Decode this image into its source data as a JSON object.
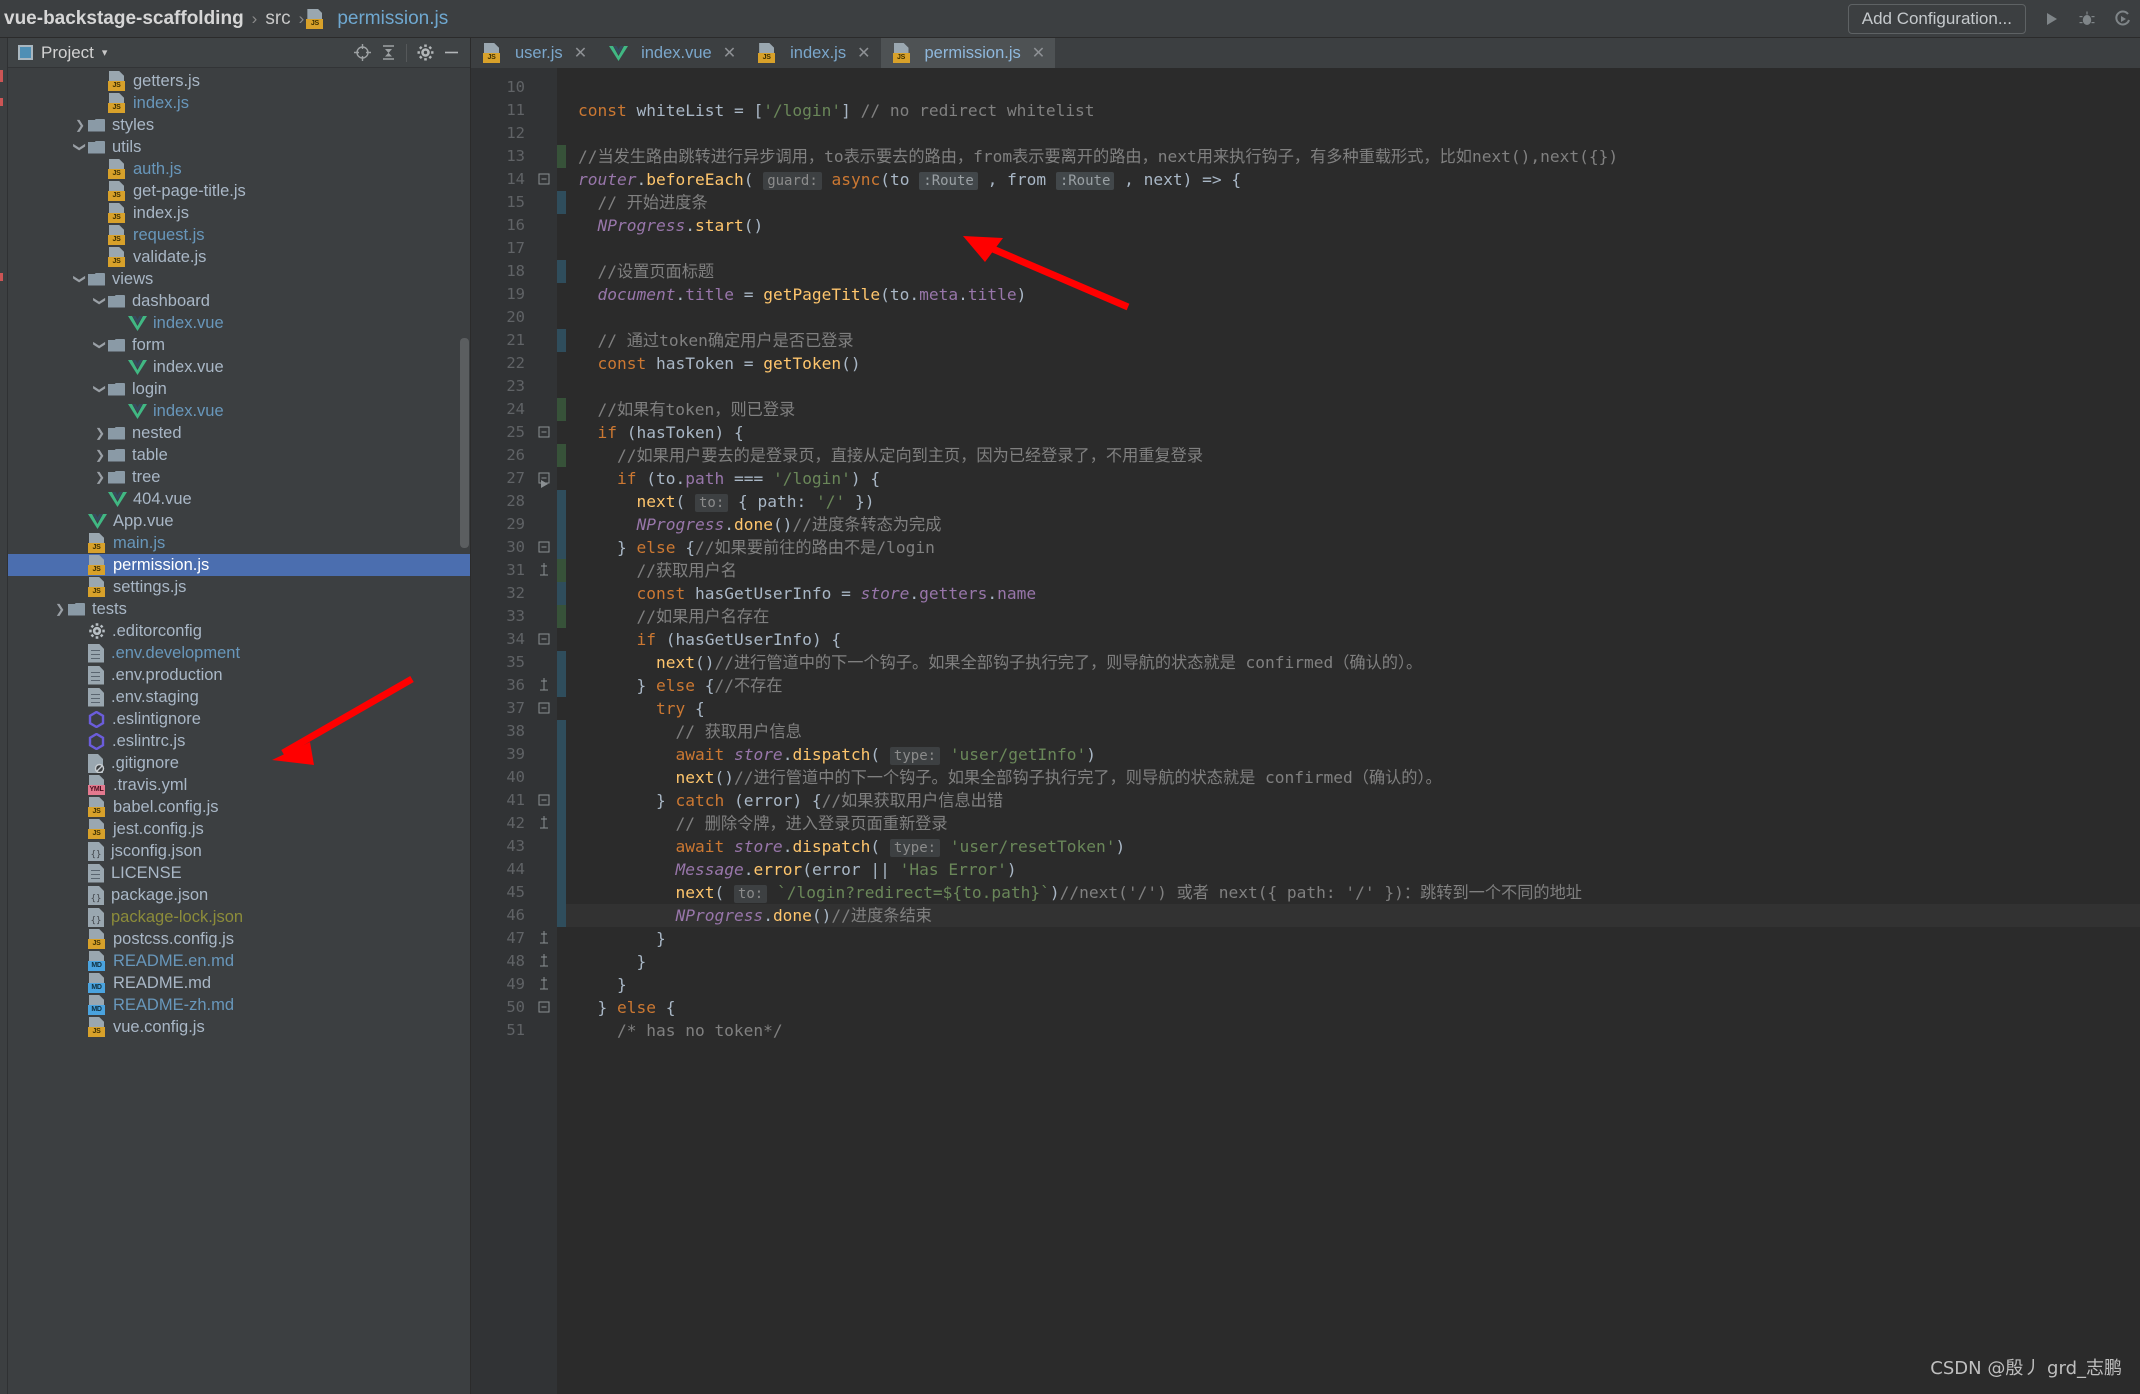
{
  "topbar": {
    "breadcrumb": [
      {
        "label": "vue-backstage-scaffolding",
        "type": "project"
      },
      {
        "label": "src",
        "type": "folder"
      },
      {
        "label": "permission.js",
        "type": "js-file"
      }
    ],
    "separator": "›",
    "add_configuration_label": "Add Configuration...",
    "run_icon": "run-icon",
    "debug_icon": "debug-icon",
    "coverage_icon": "run-with-coverage-icon"
  },
  "project_panel": {
    "title": "Project",
    "caret": "▾",
    "window_icon": "project-window-icon",
    "locate_icon": "select-opened-file-icon",
    "collapse_icon": "collapse-all-icon",
    "settings_icon": "gear-icon",
    "hide_icon": "hide-icon",
    "tree": [
      {
        "label": "getters.js",
        "indent": 4,
        "icon": "js",
        "color": "grey",
        "arrow": ""
      },
      {
        "label": "index.js",
        "indent": 4,
        "icon": "js",
        "color": "blue",
        "arrow": ""
      },
      {
        "label": "styles",
        "indent": 3,
        "icon": "folder",
        "color": "grey",
        "arrow": "›"
      },
      {
        "label": "utils",
        "indent": 3,
        "icon": "folder",
        "color": "grey",
        "arrow": "ˇ"
      },
      {
        "label": "auth.js",
        "indent": 4,
        "icon": "js",
        "color": "blue",
        "arrow": ""
      },
      {
        "label": "get-page-title.js",
        "indent": 4,
        "icon": "js",
        "color": "grey",
        "arrow": ""
      },
      {
        "label": "index.js",
        "indent": 4,
        "icon": "js",
        "color": "grey",
        "arrow": ""
      },
      {
        "label": "request.js",
        "indent": 4,
        "icon": "js",
        "color": "blue",
        "arrow": ""
      },
      {
        "label": "validate.js",
        "indent": 4,
        "icon": "js",
        "color": "grey",
        "arrow": ""
      },
      {
        "label": "views",
        "indent": 3,
        "icon": "folder",
        "color": "grey",
        "arrow": "ˇ"
      },
      {
        "label": "dashboard",
        "indent": 4,
        "icon": "folder",
        "color": "grey",
        "arrow": "ˇ"
      },
      {
        "label": "index.vue",
        "indent": 5,
        "icon": "vue",
        "color": "blue",
        "arrow": ""
      },
      {
        "label": "form",
        "indent": 4,
        "icon": "folder",
        "color": "grey",
        "arrow": "ˇ"
      },
      {
        "label": "index.vue",
        "indent": 5,
        "icon": "vue",
        "color": "grey",
        "arrow": ""
      },
      {
        "label": "login",
        "indent": 4,
        "icon": "folder",
        "color": "grey",
        "arrow": "ˇ"
      },
      {
        "label": "index.vue",
        "indent": 5,
        "icon": "vue",
        "color": "blue",
        "arrow": ""
      },
      {
        "label": "nested",
        "indent": 4,
        "icon": "folder",
        "color": "grey",
        "arrow": "›"
      },
      {
        "label": "table",
        "indent": 4,
        "icon": "folder",
        "color": "grey",
        "arrow": "›"
      },
      {
        "label": "tree",
        "indent": 4,
        "icon": "folder",
        "color": "grey",
        "arrow": "›"
      },
      {
        "label": "404.vue",
        "indent": 4,
        "icon": "vue",
        "color": "grey",
        "arrow": ""
      },
      {
        "label": "App.vue",
        "indent": 3,
        "icon": "vue",
        "color": "grey",
        "arrow": ""
      },
      {
        "label": "main.js",
        "indent": 3,
        "icon": "js",
        "color": "blue",
        "arrow": ""
      },
      {
        "label": "permission.js",
        "indent": 3,
        "icon": "js",
        "color": "white",
        "arrow": "",
        "selected": true
      },
      {
        "label": "settings.js",
        "indent": 3,
        "icon": "js",
        "color": "grey",
        "arrow": ""
      },
      {
        "label": "tests",
        "indent": 2,
        "icon": "folder",
        "color": "grey",
        "arrow": "›"
      },
      {
        "label": ".editorconfig",
        "indent": 3,
        "icon": "gear",
        "color": "grey",
        "arrow": ""
      },
      {
        "label": ".env.development",
        "indent": 3,
        "icon": "doc",
        "color": "blue",
        "arrow": ""
      },
      {
        "label": ".env.production",
        "indent": 3,
        "icon": "doc",
        "color": "grey",
        "arrow": ""
      },
      {
        "label": ".env.staging",
        "indent": 3,
        "icon": "doc",
        "color": "grey",
        "arrow": ""
      },
      {
        "label": ".eslintignore",
        "indent": 3,
        "icon": "eslint",
        "color": "grey",
        "arrow": ""
      },
      {
        "label": ".eslintrc.js",
        "indent": 3,
        "icon": "eslint",
        "color": "grey",
        "arrow": ""
      },
      {
        "label": ".gitignore",
        "indent": 3,
        "icon": "git",
        "color": "grey",
        "arrow": ""
      },
      {
        "label": ".travis.yml",
        "indent": 3,
        "icon": "yml",
        "color": "grey",
        "arrow": ""
      },
      {
        "label": "babel.config.js",
        "indent": 3,
        "icon": "js",
        "color": "grey",
        "arrow": ""
      },
      {
        "label": "jest.config.js",
        "indent": 3,
        "icon": "js",
        "color": "grey",
        "arrow": ""
      },
      {
        "label": "jsconfig.json",
        "indent": 3,
        "icon": "json",
        "color": "grey",
        "arrow": ""
      },
      {
        "label": "LICENSE",
        "indent": 3,
        "icon": "doc",
        "color": "grey",
        "arrow": ""
      },
      {
        "label": "package.json",
        "indent": 3,
        "icon": "json",
        "color": "grey",
        "arrow": ""
      },
      {
        "label": "package-lock.json",
        "indent": 3,
        "icon": "json",
        "color": "olive",
        "arrow": ""
      },
      {
        "label": "postcss.config.js",
        "indent": 3,
        "icon": "js",
        "color": "grey",
        "arrow": ""
      },
      {
        "label": "README.en.md",
        "indent": 3,
        "icon": "md",
        "color": "blue",
        "arrow": ""
      },
      {
        "label": "README.md",
        "indent": 3,
        "icon": "md",
        "color": "grey",
        "arrow": ""
      },
      {
        "label": "README-zh.md",
        "indent": 3,
        "icon": "md",
        "color": "blue",
        "arrow": ""
      },
      {
        "label": "vue.config.js",
        "indent": 3,
        "icon": "js",
        "color": "grey",
        "arrow": ""
      }
    ]
  },
  "editor": {
    "tabs": [
      {
        "label": "user.js",
        "icon": "js",
        "active": false,
        "close": "✕"
      },
      {
        "label": "index.vue",
        "icon": "vue",
        "active": false,
        "close": "✕"
      },
      {
        "label": "index.js",
        "icon": "js",
        "active": false,
        "close": "✕"
      },
      {
        "label": "permission.js",
        "icon": "js",
        "active": true,
        "close": "✕"
      }
    ],
    "first_line_number": 10,
    "caret_line": 46,
    "lines": [
      {
        "n": 10,
        "text": ""
      },
      {
        "n": 11,
        "text": "const whiteList = ['/login'] // no redirect whitelist"
      },
      {
        "n": 12,
        "text": ""
      },
      {
        "n": 13,
        "text": "//当发生路由跳转进行异步调用，to表示要去的路由，from表示要离开的路由，next用来执行钩子，有多种重载形式，比如next(),next({})"
      },
      {
        "n": 14,
        "text": "router.beforeEach( guard: async(to :Route , from :Route , next) => {"
      },
      {
        "n": 15,
        "text": "  // 开始进度条"
      },
      {
        "n": 16,
        "text": "  NProgress.start()"
      },
      {
        "n": 17,
        "text": ""
      },
      {
        "n": 18,
        "text": "  //设置页面标题"
      },
      {
        "n": 19,
        "text": "  document.title = getPageTitle(to.meta.title)"
      },
      {
        "n": 20,
        "text": ""
      },
      {
        "n": 21,
        "text": "  // 通过token确定用户是否已登录"
      },
      {
        "n": 22,
        "text": "  const hasToken = getToken()"
      },
      {
        "n": 23,
        "text": ""
      },
      {
        "n": 24,
        "text": "  //如果有token，则已登录"
      },
      {
        "n": 25,
        "text": "  if (hasToken) {"
      },
      {
        "n": 26,
        "text": "    //如果用户要去的是登录页，直接从定向到主页，因为已经登录了，不用重复登录"
      },
      {
        "n": 27,
        "text": "    if (to.path === '/login') {"
      },
      {
        "n": 28,
        "text": "      next( to: { path: '/' })"
      },
      {
        "n": 29,
        "text": "      NProgress.done()//进度条转态为完成"
      },
      {
        "n": 30,
        "text": "    } else {//如果要前往的路由不是/login"
      },
      {
        "n": 31,
        "text": "      //获取用户名"
      },
      {
        "n": 32,
        "text": "      const hasGetUserInfo = store.getters.name"
      },
      {
        "n": 33,
        "text": "      //如果用户名存在"
      },
      {
        "n": 34,
        "text": "      if (hasGetUserInfo) {"
      },
      {
        "n": 35,
        "text": "        next()//进行管道中的下一个钩子。如果全部钩子执行完了，则导航的状态就是 confirmed（确认的）。"
      },
      {
        "n": 36,
        "text": "      } else {//不存在"
      },
      {
        "n": 37,
        "text": "        try {"
      },
      {
        "n": 38,
        "text": "          // 获取用户信息"
      },
      {
        "n": 39,
        "text": "          await store.dispatch( type: 'user/getInfo')"
      },
      {
        "n": 40,
        "text": "          next()//进行管道中的下一个钩子。如果全部钩子执行完了，则导航的状态就是 confirmed（确认的）。"
      },
      {
        "n": 41,
        "text": "        } catch (error) {//如果获取用户信息出错"
      },
      {
        "n": 42,
        "text": "          // 删除令牌，进入登录页面重新登录"
      },
      {
        "n": 43,
        "text": "          await store.dispatch( type: 'user/resetToken')"
      },
      {
        "n": 44,
        "text": "          Message.error(error || 'Has Error')"
      },
      {
        "n": 45,
        "text": "          next( to: `/login?redirect=${to.path}`)//next('/') 或者 next({ path: '/' })：跳转到一个不同的地址"
      },
      {
        "n": 46,
        "text": "          NProgress.done()//进度条结束"
      },
      {
        "n": 47,
        "text": "        }"
      },
      {
        "n": 48,
        "text": "      }"
      },
      {
        "n": 49,
        "text": "    }"
      },
      {
        "n": 50,
        "text": "  } else {"
      },
      {
        "n": 51,
        "text": "    /* has no token*/"
      }
    ]
  },
  "watermark": "CSDN @殷丿 grd_志鹏",
  "colors": {
    "accent": "#4b6eaf",
    "annotation_arrow": "#ff0000",
    "editor_bg": "#2b2b2b",
    "panel_bg": "#3c3f41",
    "keyword": "#cc7832",
    "string": "#6a8759",
    "comment": "#808080",
    "function": "#ffc66d",
    "field": "#9876aa"
  }
}
